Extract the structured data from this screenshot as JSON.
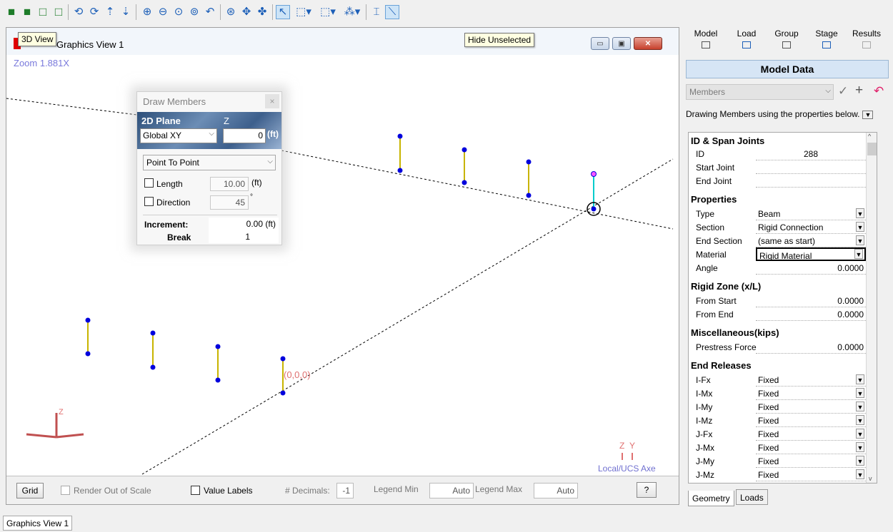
{
  "toolbar": {
    "buttons": [
      {
        "icon": "cube-icon"
      },
      {
        "icon": "cube-icon"
      },
      {
        "icon": "cube-icon"
      },
      {
        "icon": "cube-icon"
      },
      {
        "icon": "rotate-left-icon"
      },
      {
        "icon": "rotate-right-icon"
      },
      {
        "icon": "rotate-up-icon"
      },
      {
        "icon": "rotate-down-icon"
      },
      {
        "icon": "zoom-in-icon"
      },
      {
        "icon": "zoom-out-icon"
      },
      {
        "icon": "zoom-window-icon"
      },
      {
        "icon": "zoom-extents-icon"
      },
      {
        "icon": "zoom-previous-icon"
      },
      {
        "icon": "zoom-selection-icon"
      },
      {
        "icon": "pan-icon"
      },
      {
        "icon": "rotate-free-icon"
      },
      {
        "icon": "select-pointer-icon"
      },
      {
        "icon": "select-box-icon"
      },
      {
        "icon": "select-window-icon"
      },
      {
        "icon": "snap-icon"
      },
      {
        "icon": "dimension-icon"
      },
      {
        "icon": "draw-member-icon"
      }
    ]
  },
  "graphics_view": {
    "title": "Graphics View 1",
    "tooltip_3d": "3D View",
    "tooltip_hide": "Hide Unselected",
    "zoom": "Zoom  1.881X",
    "origin_label": "(0,0,0)",
    "axis_z": "Z",
    "axis_y": "Y",
    "local_ucs": "Local/UCS Axe",
    "triad_z": "Z"
  },
  "draw_members": {
    "title": "Draw Members",
    "close": "×",
    "plane_label": "2D Plane",
    "z_label": "Z",
    "plane_value": "Global XY",
    "z_value": "0",
    "z_unit": "(ft)",
    "mode": "Point To Point",
    "length_label": "Length",
    "length_value": "10.00",
    "length_unit": "(ft)",
    "direction_label": "Direction",
    "direction_value": "45",
    "direction_unit": "°",
    "increment_label": "Increment:",
    "increment_value": "0.00 (ft)",
    "break_label": "Break",
    "break_value": "1"
  },
  "legend_bar": {
    "grid": "Grid",
    "render_out_of_scale": "Render Out of Scale",
    "value_labels": "Value Labels",
    "decimals_label": "# Decimals:",
    "decimals_value": "-1",
    "legend_min_label": "Legend Min",
    "legend_min_value": "Auto",
    "legend_max_label": "Legend Max",
    "legend_max_value": "Auto",
    "help": "?"
  },
  "right_panel": {
    "tabs": [
      "Model",
      "Load",
      "Group",
      "Stage",
      "Results"
    ],
    "header": "Model Data",
    "selector": "Members",
    "description": "Drawing Members using the properties below.",
    "sections": {
      "id_span": "ID & Span Joints",
      "properties": "Properties",
      "rigid_zone": "Rigid Zone (x/L)",
      "misc": "Miscellaneous(kips)",
      "end_releases": "End Releases"
    },
    "rows": {
      "id": {
        "k": "ID",
        "v": "288"
      },
      "start_joint": {
        "k": "Start Joint",
        "v": ""
      },
      "end_joint": {
        "k": "End Joint",
        "v": ""
      },
      "type": {
        "k": "Type",
        "v": "Beam"
      },
      "section": {
        "k": "Section",
        "v": "Rigid Connection"
      },
      "end_section": {
        "k": "End Section",
        "v": "(same as start)"
      },
      "material": {
        "k": "Material",
        "v": "Rigid Material"
      },
      "angle": {
        "k": "Angle",
        "v": "0.0000"
      },
      "from_start": {
        "k": "From Start",
        "v": "0.0000"
      },
      "from_end": {
        "k": "From End",
        "v": "0.0000"
      },
      "prestress": {
        "k": "Prestress Force",
        "v": "0.0000"
      }
    },
    "releases": [
      {
        "k": "I-Fx",
        "v": "Fixed"
      },
      {
        "k": "I-Mx",
        "v": "Fixed"
      },
      {
        "k": "I-My",
        "v": "Fixed"
      },
      {
        "k": "I-Mz",
        "v": "Fixed"
      },
      {
        "k": "J-Fx",
        "v": "Fixed"
      },
      {
        "k": "J-Mx",
        "v": "Fixed"
      },
      {
        "k": "J-My",
        "v": "Fixed"
      },
      {
        "k": "J-Mz",
        "v": "Fixed"
      }
    ],
    "bottom_tabs": [
      "Geometry",
      "Loads"
    ]
  },
  "status": {
    "tab": "Graphics View 1"
  },
  "colors": {
    "member": "#c8b400",
    "joint": "#0000dd",
    "selected": "#00cccc",
    "origin": "#e07070",
    "local_axes": "#7070d0"
  }
}
